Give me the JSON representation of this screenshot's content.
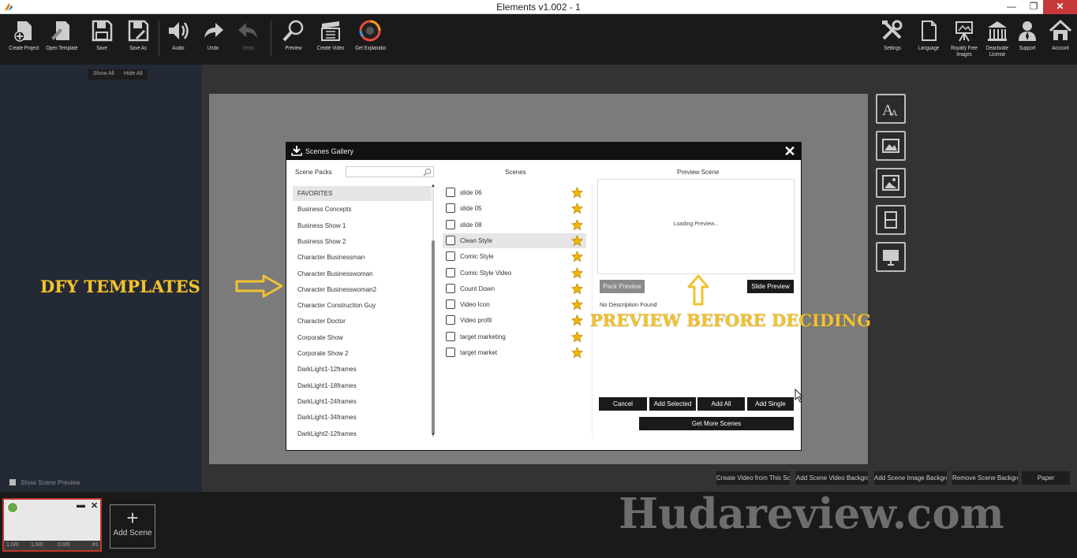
{
  "window": {
    "title": "Elements v1.002 - 1",
    "minimize": "—",
    "restore": "❐",
    "close": "✕"
  },
  "toolbar": {
    "left": [
      {
        "label": "Create Project",
        "icon": "create-project-icon"
      },
      {
        "label": "Open Template",
        "icon": "open-template-icon"
      },
      {
        "label": "Save",
        "icon": "save-icon"
      },
      {
        "label": "Save As",
        "icon": "save-as-icon"
      },
      {
        "label": "Audio",
        "icon": "speaker-icon"
      },
      {
        "label": "Undo",
        "icon": "undo-icon"
      },
      {
        "label": "Redo",
        "icon": "redo-icon",
        "disabled": true
      },
      {
        "label": "Preview",
        "icon": "magnifier-icon"
      },
      {
        "label": "Create Video",
        "icon": "clapperboard-icon"
      },
      {
        "label": "Get Explaindio",
        "icon": "explaindio-logo-icon"
      }
    ],
    "right": [
      {
        "label": "Settings",
        "icon": "tools-icon"
      },
      {
        "label": "Language",
        "icon": "document-icon"
      },
      {
        "label": "Royalty Free Images",
        "icon": "easel-icon"
      },
      {
        "label": "Deactivate License",
        "icon": "building-icon"
      },
      {
        "label": "Support",
        "icon": "support-person-icon"
      },
      {
        "label": "Account",
        "icon": "home-icon"
      }
    ]
  },
  "left_panel": {
    "show_all": "Show All",
    "hide_all": "Hide All",
    "show_scene_preview": "Show Scene Preview"
  },
  "bottom_buttons": [
    "Create Video from This Scene",
    "Add Scene Video Background",
    "Add Scene Image Background",
    "Remove Scene Background",
    "Paper"
  ],
  "timeline": {
    "thumb_values": [
      "1.0/0",
      "1.0/0",
      "0.0/0",
      "#1"
    ],
    "add_scene": "Add Scene"
  },
  "watermark": "Hudareview.com",
  "dialog": {
    "title": "Scenes Gallery",
    "close": "✕",
    "scene_packs_label": "Scene Packs",
    "scenes_label": "Scenes",
    "preview_label": "Preview Scene",
    "scene_packs": [
      "FAVORITES",
      "Business Concepts",
      "Business Show 1",
      "Business Show 2",
      "Character Businessman",
      "Character Businesswoman",
      "Character Businesswoman2",
      "Character Construction Guy",
      "Character Doctor",
      "Corporate Show",
      "Corporate Show 2",
      "DarkLight1-12frames",
      "DarkLight1-18frames",
      "DarkLight1-24frames",
      "DarkLight1-34frames",
      "DarkLight2-12frames"
    ],
    "selected_pack": "FAVORITES",
    "scenes": [
      "slide 06",
      "slide 05",
      "slide 08",
      "Clean Style",
      "Comic Style",
      "Comic Style Video",
      "Count Down",
      "Video Icon",
      "Video profit",
      "target marketing",
      "target market"
    ],
    "selected_scene": "Clean Style",
    "loading": "Loading Preview...",
    "pack_preview": "Pack Preview",
    "slide_preview": "Slide Preview",
    "no_description": "No Description Found",
    "cancel": "Cancel",
    "add_selected": "Add Selected",
    "add_all": "Add All",
    "add_single": "Add Single",
    "get_more": "Get More Scenes"
  },
  "annotations": {
    "dfy": "DFY TEMPLATES",
    "preview": "PREVIEW BEFORE DECIDING"
  },
  "colors": {
    "annotation": "#f1c232",
    "star": "#f1b500",
    "toolbar_bg": "#1a1a1a",
    "close_red": "#c7383a"
  }
}
